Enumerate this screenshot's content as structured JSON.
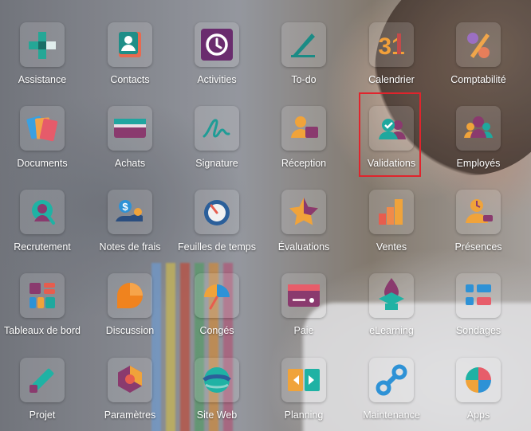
{
  "apps": [
    {
      "label": "Assistance"
    },
    {
      "label": "Contacts"
    },
    {
      "label": "Activities"
    },
    {
      "label": "To-do"
    },
    {
      "label": "Calendrier",
      "icon_text": "31"
    },
    {
      "label": "Comptabilité"
    },
    {
      "label": "Documents"
    },
    {
      "label": "Achats"
    },
    {
      "label": "Signature"
    },
    {
      "label": "Réception"
    },
    {
      "label": "Validations"
    },
    {
      "label": "Employés"
    },
    {
      "label": "Recrutement"
    },
    {
      "label": "Notes de frais",
      "icon_text": "$"
    },
    {
      "label": "Feuilles de temps"
    },
    {
      "label": "Évaluations"
    },
    {
      "label": "Ventes"
    },
    {
      "label": "Présences"
    },
    {
      "label": "Tableaux de bord"
    },
    {
      "label": "Discussion"
    },
    {
      "label": "Congés"
    },
    {
      "label": "Paie"
    },
    {
      "label": "eLearning"
    },
    {
      "label": "Sondages"
    },
    {
      "label": "Projet"
    },
    {
      "label": "Paramètres"
    },
    {
      "label": "Site Web"
    },
    {
      "label": "Planning"
    },
    {
      "label": "Maintenance"
    },
    {
      "label": "Apps"
    }
  ],
  "highlight_color": "#e0242c",
  "tile_background": "rgba(255,255,255,0.14)"
}
